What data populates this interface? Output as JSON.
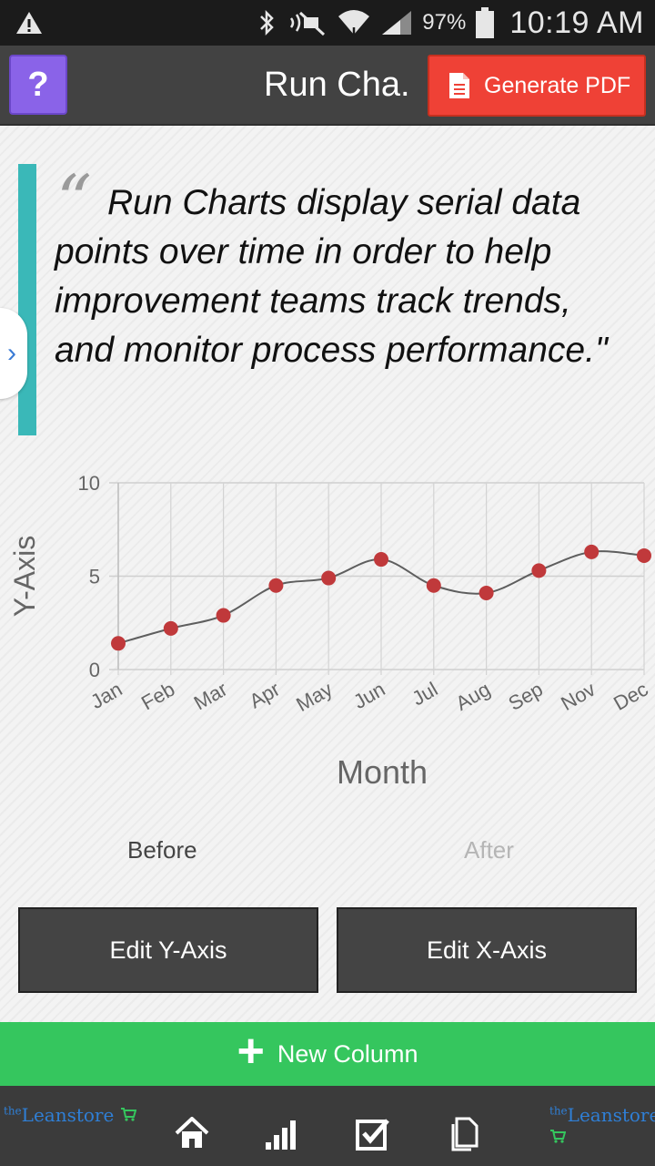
{
  "status_bar": {
    "battery_percent": "97%",
    "time": "10:19 AM"
  },
  "app_bar": {
    "help_label": "?",
    "title": "Run Cha.",
    "pdf_label": "Generate PDF"
  },
  "quote": {
    "mark": "“",
    "text": "Run Charts display serial data points over time in order to help improvement teams track trends, and monitor process performance.\""
  },
  "drawer": {
    "handle_label": "›"
  },
  "chart_data": {
    "type": "line",
    "categories": [
      "Jan",
      "Feb",
      "Mar",
      "Apr",
      "May",
      "Jun",
      "Jul",
      "Aug",
      "Sep",
      "Nov",
      "Dec"
    ],
    "series": [
      {
        "values": [
          1.4,
          2.2,
          2.9,
          4.5,
          4.9,
          5.9,
          4.5,
          4.1,
          5.3,
          6.3,
          6.1
        ]
      }
    ],
    "xlabel": "Month",
    "ylabel": "Y-Axis",
    "ylim": [
      0,
      10
    ],
    "yticks": [
      "0",
      "5",
      "10"
    ],
    "grid": true,
    "line_color": "#5e5e5e",
    "point_color": "#c0393b"
  },
  "legend": {
    "before": "Before",
    "after": "After"
  },
  "buttons": {
    "edit_y": "Edit Y-Axis",
    "edit_x": "Edit X-Axis"
  },
  "new_column": {
    "plus": "+",
    "label": "New Column"
  },
  "bottom_nav": {
    "logo_text_small": "the",
    "logo_text": "Leanstore"
  },
  "colors": {
    "accent_teal": "#3ab8b8",
    "pdf_red": "#ef4136",
    "help_purple": "#8a63e8",
    "green": "#35c65e"
  }
}
